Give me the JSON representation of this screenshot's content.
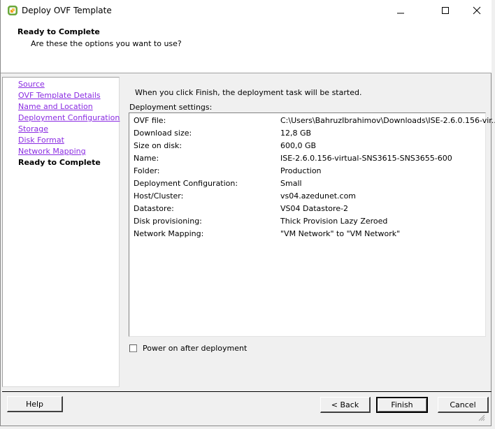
{
  "window": {
    "title": "Deploy OVF Template",
    "controls": {
      "minimize": "—",
      "maximize": "☐",
      "close": "✕"
    }
  },
  "header": {
    "heading": "Ready to Complete",
    "subheading": "Are these the options you want to use?"
  },
  "sidebar": {
    "items": [
      {
        "label": "Source",
        "state": "visited"
      },
      {
        "label": "OVF Template Details",
        "state": "visited"
      },
      {
        "label": "Name and Location",
        "state": "visited"
      },
      {
        "label": "Deployment Configuration",
        "state": "visited"
      },
      {
        "label": "Storage",
        "state": "visited"
      },
      {
        "label": "Disk Format",
        "state": "visited"
      },
      {
        "label": "Network Mapping",
        "state": "visited"
      },
      {
        "label": "Ready to Complete",
        "state": "current"
      }
    ]
  },
  "main": {
    "intro": "When you click Finish, the deployment task will be started.",
    "settings_label": "Deployment settings:",
    "settings": [
      {
        "key": "OVF file:",
        "value": "C:\\Users\\BahruzIbrahimov\\Downloads\\ISE-2.6.0.156-vir..."
      },
      {
        "key": "Download size:",
        "value": "12,8 GB"
      },
      {
        "key": "Size on disk:",
        "value": "600,0 GB"
      },
      {
        "key": "Name:",
        "value": "ISE-2.6.0.156-virtual-SNS3615-SNS3655-600"
      },
      {
        "key": "Folder:",
        "value": "Production"
      },
      {
        "key": "Deployment Configuration:",
        "value": "Small"
      },
      {
        "key": "Host/Cluster:",
        "value": "vs04.azedunet.com"
      },
      {
        "key": "Datastore:",
        "value": "VS04 Datastore-2"
      },
      {
        "key": "Disk provisioning:",
        "value": "Thick Provision Lazy Zeroed"
      },
      {
        "key": "Network Mapping:",
        "value": "\"VM Network\" to \"VM Network\""
      }
    ],
    "power_on_label": "Power on after deployment",
    "power_on_checked": false
  },
  "footer": {
    "help": "Help",
    "back": "< Back",
    "finish": "Finish",
    "cancel": "Cancel"
  },
  "colors": {
    "link_visited": "#8a2be2",
    "icon_green": "#6aa83a",
    "icon_orange": "#f0a020"
  }
}
